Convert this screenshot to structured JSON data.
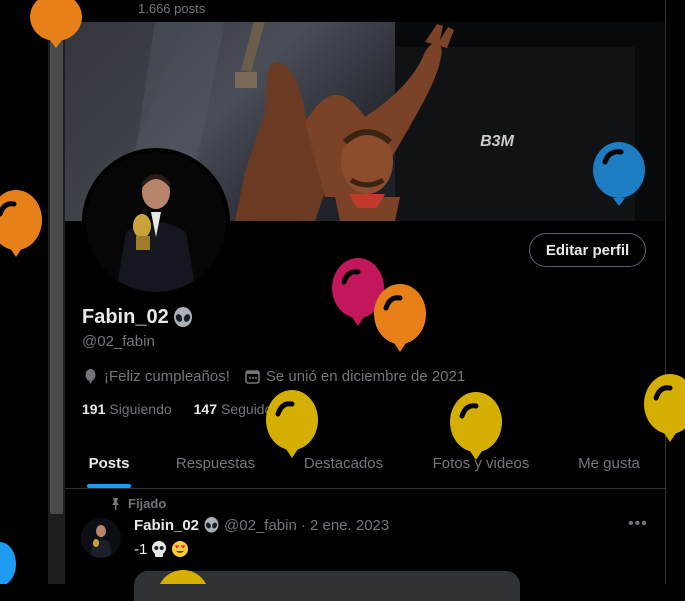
{
  "header": {
    "posts_count": "1.666 posts"
  },
  "profile": {
    "display_name": "Fabin_02",
    "handle": "@02_fabin",
    "edit_button": "Editar perfil",
    "birthday": "¡Feliz cumpleaños!",
    "joined": "Se unió en diciembre de 2021",
    "following_count": "191",
    "following_label": "Siguiendo",
    "followers_count": "147",
    "followers_label": "Seguidores"
  },
  "tabs": [
    {
      "label": "Posts",
      "active": true
    },
    {
      "label": "Respuestas",
      "active": false
    },
    {
      "label": "Destacados",
      "active": false
    },
    {
      "label": "Fotos y videos",
      "active": false
    },
    {
      "label": "Me gusta",
      "active": false
    }
  ],
  "pinned_tweet": {
    "pinned_label": "Fijado",
    "name": "Fabin_02",
    "handle": "@02_fabin",
    "date": "· 2 ene. 2023",
    "text": "-1"
  },
  "banner": {
    "badge_text": "B3M"
  },
  "balloon_colors": [
    "#e8801a",
    "#1d7cc2",
    "#c2185b",
    "#d4af00"
  ],
  "icons": [
    "balloon-icon",
    "calendar-icon",
    "pin-icon",
    "alien-emoji-icon",
    "skull-emoji-icon",
    "heart-eyes-emoji-icon",
    "more-icon"
  ]
}
